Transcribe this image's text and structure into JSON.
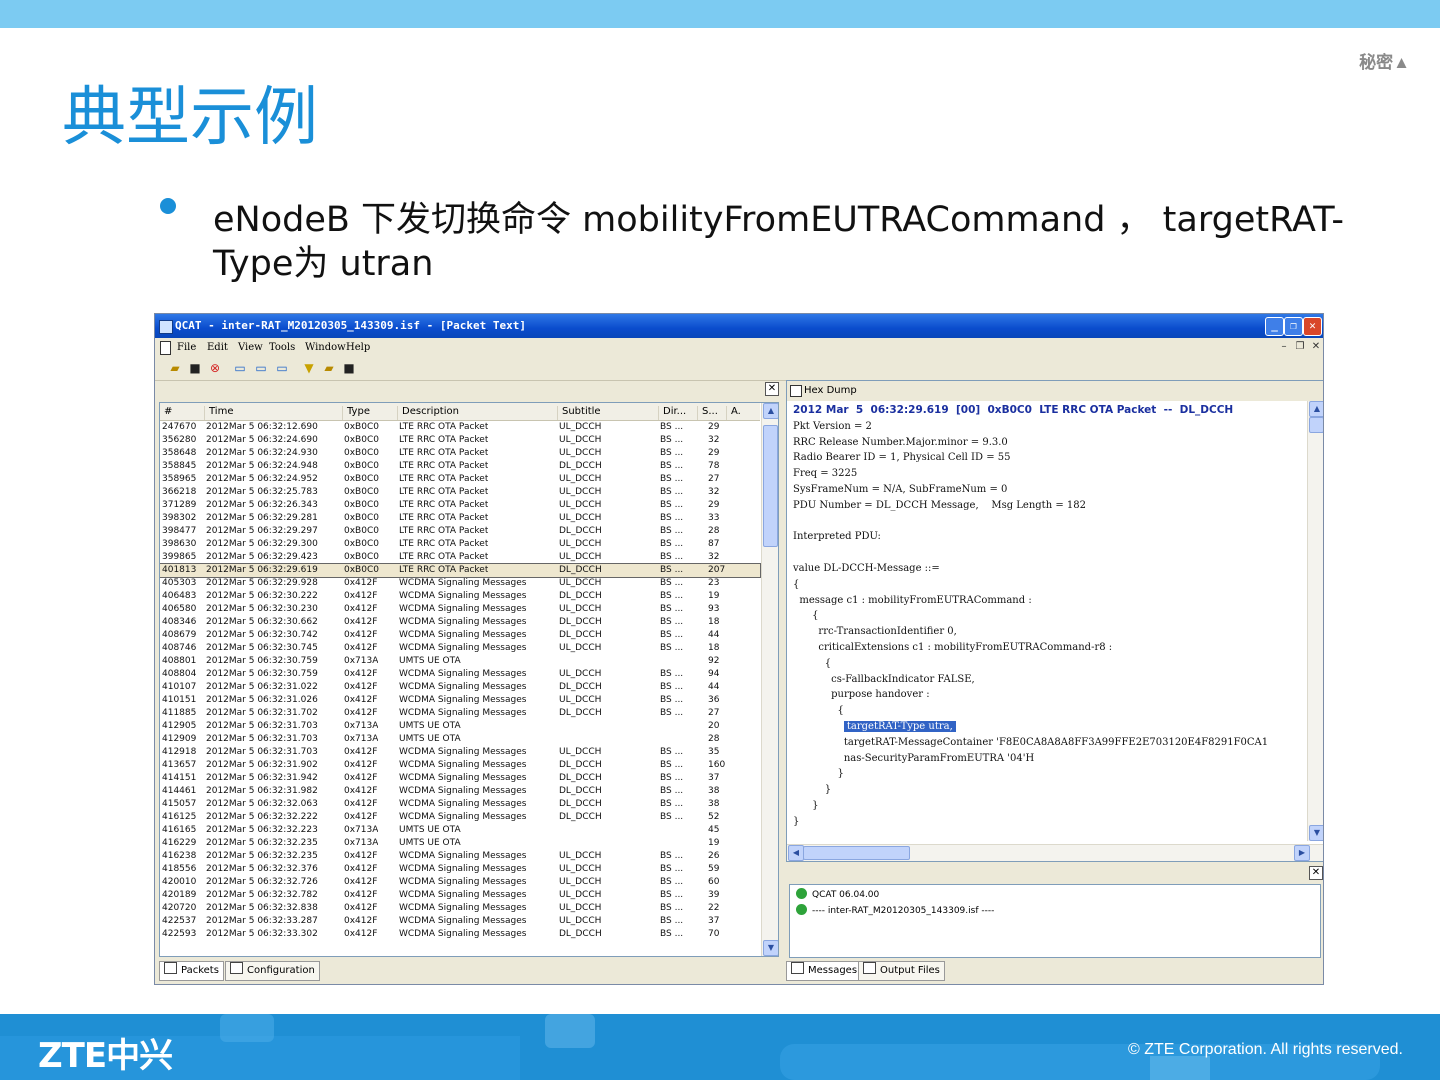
{
  "slide": {
    "secret_label": "秘密▲",
    "title": "典型示例",
    "bullet": "eNodeB 下发切换命令 mobilityFromEUTRACommand ， targetRAT-Type为 utran",
    "footer_copyright": "© ZTE Corporation. All rights reserved.",
    "logo": "ZTE中兴"
  },
  "app": {
    "title": "QCAT - inter-RAT_M20120305_143309.isf - [Packet Text]",
    "menu": [
      "File",
      "Edit",
      "View",
      "Tools",
      "Window",
      "Help"
    ],
    "toolbar_icons": [
      "open-icon",
      "save-icon",
      "stop-icon",
      "packet-icon",
      "packet-next-icon",
      "packet-prev-icon",
      "filter-icon",
      "open-folder-icon",
      "save-disk-icon"
    ]
  },
  "packet_list": {
    "columns": [
      "#",
      "Time",
      "Type",
      "Description",
      "Subtitle",
      "Dir...",
      "S...",
      "A."
    ],
    "selected_index": 11,
    "rows": [
      [
        "247670",
        "2012Mar  5 06:32:12.690",
        "0xB0C0",
        "LTE RRC OTA Packet",
        "UL_DCCH",
        "BS ...",
        "29"
      ],
      [
        "356280",
        "2012Mar  5 06:32:24.690",
        "0xB0C0",
        "LTE RRC OTA Packet",
        "UL_DCCH",
        "BS ...",
        "32"
      ],
      [
        "358648",
        "2012Mar  5 06:32:24.930",
        "0xB0C0",
        "LTE RRC OTA Packet",
        "UL_DCCH",
        "BS ...",
        "29"
      ],
      [
        "358845",
        "2012Mar  5 06:32:24.948",
        "0xB0C0",
        "LTE RRC OTA Packet",
        "DL_DCCH",
        "BS ...",
        "78"
      ],
      [
        "358965",
        "2012Mar  5 06:32:24.952",
        "0xB0C0",
        "LTE RRC OTA Packet",
        "UL_DCCH",
        "BS ...",
        "27"
      ],
      [
        "366218",
        "2012Mar  5 06:32:25.783",
        "0xB0C0",
        "LTE RRC OTA Packet",
        "UL_DCCH",
        "BS ...",
        "32"
      ],
      [
        "371289",
        "2012Mar  5 06:32:26.343",
        "0xB0C0",
        "LTE RRC OTA Packet",
        "UL_DCCH",
        "BS ...",
        "29"
      ],
      [
        "398302",
        "2012Mar  5 06:32:29.281",
        "0xB0C0",
        "LTE RRC OTA Packet",
        "UL_DCCH",
        "BS ...",
        "33"
      ],
      [
        "398477",
        "2012Mar  5 06:32:29.297",
        "0xB0C0",
        "LTE RRC OTA Packet",
        "DL_DCCH",
        "BS ...",
        "28"
      ],
      [
        "398630",
        "2012Mar  5 06:32:29.300",
        "0xB0C0",
        "LTE RRC OTA Packet",
        "UL_DCCH",
        "BS ...",
        "87"
      ],
      [
        "399865",
        "2012Mar  5 06:32:29.423",
        "0xB0C0",
        "LTE RRC OTA Packet",
        "UL_DCCH",
        "BS ...",
        "32"
      ],
      [
        "401813",
        "2012Mar  5 06:32:29.619",
        "0xB0C0",
        "LTE RRC OTA Packet",
        "DL_DCCH",
        "BS ...",
        "207"
      ],
      [
        "405303",
        "2012Mar  5 06:32:29.928",
        "0x412F",
        "WCDMA Signaling Messages",
        "UL_DCCH",
        "BS ...",
        "23"
      ],
      [
        "406483",
        "2012Mar  5 06:32:30.222",
        "0x412F",
        "WCDMA Signaling Messages",
        "DL_DCCH",
        "BS ...",
        "19"
      ],
      [
        "406580",
        "2012Mar  5 06:32:30.230",
        "0x412F",
        "WCDMA Signaling Messages",
        "UL_DCCH",
        "BS ...",
        "93"
      ],
      [
        "408346",
        "2012Mar  5 06:32:30.662",
        "0x412F",
        "WCDMA Signaling Messages",
        "DL_DCCH",
        "BS ...",
        "18"
      ],
      [
        "408679",
        "2012Mar  5 06:32:30.742",
        "0x412F",
        "WCDMA Signaling Messages",
        "DL_DCCH",
        "BS ...",
        "44"
      ],
      [
        "408746",
        "2012Mar  5 06:32:30.745",
        "0x412F",
        "WCDMA Signaling Messages",
        "UL_DCCH",
        "BS ...",
        "18"
      ],
      [
        "408801",
        "2012Mar  5 06:32:30.759",
        "0x713A",
        "UMTS UE OTA",
        "",
        "",
        "92"
      ],
      [
        "408804",
        "2012Mar  5 06:32:30.759",
        "0x412F",
        "WCDMA Signaling Messages",
        "UL_DCCH",
        "BS ...",
        "94"
      ],
      [
        "410107",
        "2012Mar  5 06:32:31.022",
        "0x412F",
        "WCDMA Signaling Messages",
        "DL_DCCH",
        "BS ...",
        "44"
      ],
      [
        "410151",
        "2012Mar  5 06:32:31.026",
        "0x412F",
        "WCDMA Signaling Messages",
        "UL_DCCH",
        "BS ...",
        "36"
      ],
      [
        "411885",
        "2012Mar  5 06:32:31.702",
        "0x412F",
        "WCDMA Signaling Messages",
        "DL_DCCH",
        "BS ...",
        "27"
      ],
      [
        "412905",
        "2012Mar  5 06:32:31.703",
        "0x713A",
        "UMTS UE OTA",
        "",
        "",
        "20"
      ],
      [
        "412909",
        "2012Mar  5 06:32:31.703",
        "0x713A",
        "UMTS UE OTA",
        "",
        "",
        "28"
      ],
      [
        "412918",
        "2012Mar  5 06:32:31.703",
        "0x412F",
        "WCDMA Signaling Messages",
        "UL_DCCH",
        "BS ...",
        "35"
      ],
      [
        "413657",
        "2012Mar  5 06:32:31.902",
        "0x412F",
        "WCDMA Signaling Messages",
        "DL_DCCH",
        "BS ...",
        "160"
      ],
      [
        "414151",
        "2012Mar  5 06:32:31.942",
        "0x412F",
        "WCDMA Signaling Messages",
        "DL_DCCH",
        "BS ...",
        "37"
      ],
      [
        "414461",
        "2012Mar  5 06:32:31.982",
        "0x412F",
        "WCDMA Signaling Messages",
        "DL_DCCH",
        "BS ...",
        "38"
      ],
      [
        "415057",
        "2012Mar  5 06:32:32.063",
        "0x412F",
        "WCDMA Signaling Messages",
        "DL_DCCH",
        "BS ...",
        "38"
      ],
      [
        "416125",
        "2012Mar  5 06:32:32.222",
        "0x412F",
        "WCDMA Signaling Messages",
        "DL_DCCH",
        "BS ...",
        "52"
      ],
      [
        "416165",
        "2012Mar  5 06:32:32.223",
        "0x713A",
        "UMTS UE OTA",
        "",
        "",
        "45"
      ],
      [
        "416229",
        "2012Mar  5 06:32:32.235",
        "0x713A",
        "UMTS UE OTA",
        "",
        "",
        "19"
      ],
      [
        "416238",
        "2012Mar  5 06:32:32.235",
        "0x412F",
        "WCDMA Signaling Messages",
        "UL_DCCH",
        "BS ...",
        "26"
      ],
      [
        "418556",
        "2012Mar  5 06:32:32.376",
        "0x412F",
        "WCDMA Signaling Messages",
        "UL_DCCH",
        "BS ...",
        "59"
      ],
      [
        "420010",
        "2012Mar  5 06:32:32.726",
        "0x412F",
        "WCDMA Signaling Messages",
        "UL_DCCH",
        "BS ...",
        "60"
      ],
      [
        "420189",
        "2012Mar  5 06:32:32.782",
        "0x412F",
        "WCDMA Signaling Messages",
        "UL_DCCH",
        "BS ...",
        "39"
      ],
      [
        "420720",
        "2012Mar  5 06:32:32.838",
        "0x412F",
        "WCDMA Signaling Messages",
        "UL_DCCH",
        "BS ...",
        "22"
      ],
      [
        "422537",
        "2012Mar  5 06:32:33.287",
        "0x412F",
        "WCDMA Signaling Messages",
        "UL_DCCH",
        "BS ...",
        "37"
      ],
      [
        "422593",
        "2012Mar  5 06:32:33.302",
        "0x412F",
        "WCDMA Signaling Messages",
        "DL_DCCH",
        "BS ...",
        "70"
      ]
    ],
    "tabs": [
      "Packets",
      "Configuration"
    ]
  },
  "packet_text": {
    "hex_dump_label": "Hex Dump",
    "header": "2012 Mar  5  06:32:29.619  [00]  0xB0C0  LTE RRC OTA Packet  --  DL_DCCH",
    "lines": [
      "Pkt Version = 2",
      "RRC Release Number.Major.minor = 9.3.0",
      "Radio Bearer ID = 1, Physical Cell ID = 55",
      "Freq = 3225",
      "SysFrameNum = N/A, SubFrameNum = 0",
      "PDU Number = DL_DCCH Message,    Msg Length = 182",
      "",
      "Interpreted PDU:",
      "",
      "value DL-DCCH-Message ::=",
      "{",
      "  message c1 : mobilityFromEUTRACommand :",
      "      {",
      "        rrc-TransactionIdentifier 0,",
      "        criticalExtensions c1 : mobilityFromEUTRACommand-r8 :",
      "          {",
      "            cs-FallbackIndicator FALSE,",
      "            purpose handover :",
      "              {",
      "                targetRAT-Type utra,",
      "                targetRAT-MessageContainer 'F8E0CA8A8A8FF3A99FFE2E703120E4F8291F0CA1",
      "                nas-SecurityParamFromEUTRA '04'H",
      "              }",
      "          }",
      "      }",
      "}"
    ],
    "highlight_line": 19
  },
  "messages": {
    "lines": [
      "QCAT 06.04.00",
      "---- inter-RAT_M20120305_143309.isf ----"
    ],
    "tabs": [
      "Messages",
      "Output Files"
    ]
  }
}
